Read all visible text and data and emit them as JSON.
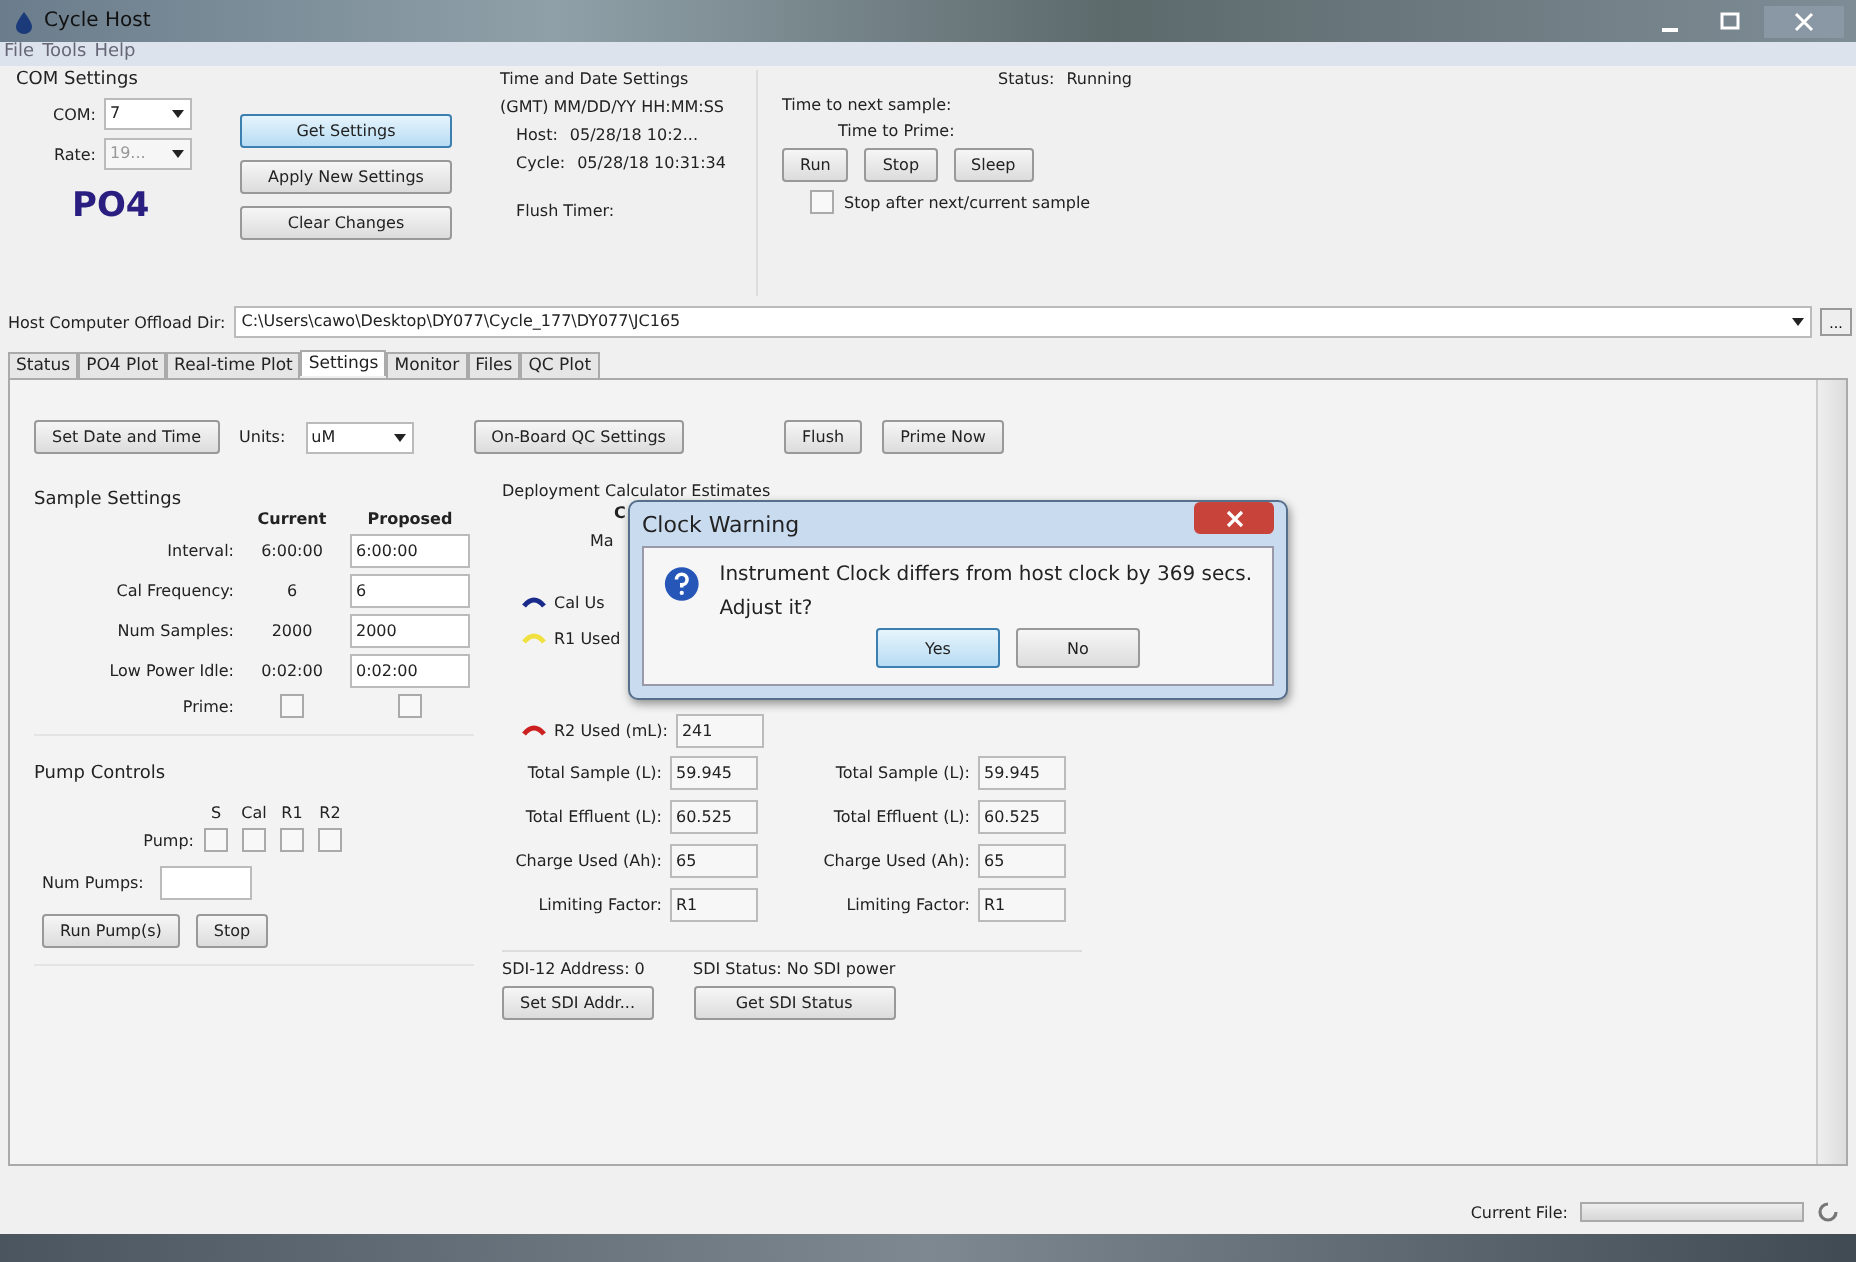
{
  "window": {
    "title": "Cycle Host"
  },
  "menu": [
    "File",
    "Tools",
    "Help"
  ],
  "com_settings": {
    "title": "COM Settings",
    "com_label": "COM:",
    "com_value": "7",
    "rate_label": "Rate:",
    "rate_value": "19...",
    "rate_disabled": true,
    "analyte": "PO4"
  },
  "settings_buttons": [
    {
      "label": "Get Settings",
      "selected": true
    },
    {
      "label": "Apply New Settings",
      "selected": false
    },
    {
      "label": "Clear Changes",
      "selected": false
    }
  ],
  "time_settings": {
    "title": "Time and Date Settings",
    "format": "(GMT) MM/DD/YY HH:MM:SS",
    "host_label": "Host:",
    "host_value": "05/28/18 10:2...",
    "cycle_label": "Cycle:",
    "cycle_value": "05/28/18 10:31:34",
    "flush_label": "Flush Timer:"
  },
  "status": {
    "status_label": "Status:",
    "status_value": "Running",
    "next_sample": "Time to next sample:",
    "prime": "Time to Prime:",
    "buttons": [
      "Run",
      "Stop",
      "Sleep"
    ],
    "stop_after": {
      "label": "Stop after next/current sample",
      "checked": false
    }
  },
  "offload": {
    "label": "Host Computer Offload Dir:",
    "value": "C:\\Users\\cawo\\Desktop\\DY077\\Cycle_177\\DY077\\JC165",
    "browse": "..."
  },
  "tabs": [
    {
      "label": "Status",
      "selected": false
    },
    {
      "label": "PO4 Plot",
      "selected": false
    },
    {
      "label": "Real-time Plot",
      "selected": false
    },
    {
      "label": "Settings",
      "selected": true
    },
    {
      "label": "Monitor",
      "selected": false
    },
    {
      "label": "Files",
      "selected": false
    },
    {
      "label": "QC Plot",
      "selected": false
    }
  ],
  "toolbar": {
    "set_date": "Set Date and Time",
    "units_label": "Units:",
    "units_value": "uM",
    "qc": "On-Board QC Settings",
    "flush": "Flush",
    "prime_now": "Prime Now"
  },
  "sample_settings": {
    "title": "Sample Settings",
    "col_current": "Current",
    "col_proposed": "Proposed",
    "rows": [
      {
        "label": "Interval:",
        "current": "6:00:00",
        "proposed": "6:00:00"
      },
      {
        "label": "Cal Frequency:",
        "current": "6",
        "proposed": "6"
      },
      {
        "label": "Num Samples:",
        "current": "2000",
        "proposed": "2000"
      },
      {
        "label": "Low Power Idle:",
        "current": "0:02:00",
        "proposed": "0:02:00"
      }
    ],
    "prime": {
      "label": "Prime:",
      "current_checked": false,
      "proposed_checked": false
    }
  },
  "pump_controls": {
    "title": "Pump Controls",
    "label": "Pump:",
    "pumps": [
      {
        "label": "S",
        "checked": false
      },
      {
        "label": "Cal",
        "checked": false
      },
      {
        "label": "R1",
        "checked": false
      },
      {
        "label": "R2",
        "checked": false
      }
    ],
    "num_label": "Num Pumps:",
    "run": "Run Pump(s)",
    "stop": "Stop"
  },
  "estimates": {
    "title": "Deployment Calculator Estimates",
    "fragment_1": "C",
    "fragment_2": "Ma",
    "legend": [
      {
        "label": "Cal Us",
        "color": "#1a2a8a"
      },
      {
        "label": "R1 Used",
        "color": "#f0e040"
      }
    ],
    "r2": {
      "label": "R2 Used (mL):",
      "value": "241",
      "color": "#cc2020"
    },
    "columns": [
      [
        {
          "label": "Total Sample (L):",
          "value": "59.945"
        },
        {
          "label": "Total Effluent (L):",
          "value": "60.525"
        },
        {
          "label": "Charge Used (Ah):",
          "value": "65"
        },
        {
          "label": "Limiting Factor:",
          "value": "R1"
        }
      ],
      [
        {
          "label": "Total Sample (L):",
          "value": "59.945"
        },
        {
          "label": "Total Effluent (L):",
          "value": "60.525"
        },
        {
          "label": "Charge Used (Ah):",
          "value": "65"
        },
        {
          "label": "Limiting Factor:",
          "value": "R1"
        }
      ]
    ]
  },
  "sdi": {
    "address": "SDI-12 Address:  0",
    "status": "SDI Status: No SDI power",
    "set": "Set SDI Addr...",
    "get": "Get SDI Status"
  },
  "status_bar": {
    "current_file": "Current File:",
    "level": 0
  },
  "dialog": {
    "title": "Clock Warning",
    "message": "Instrument Clock differs from host clock by 369 secs.",
    "question": "Adjust it?",
    "buttons": [
      {
        "label": "Yes",
        "selected": true
      },
      {
        "label": "No",
        "selected": false
      }
    ]
  }
}
